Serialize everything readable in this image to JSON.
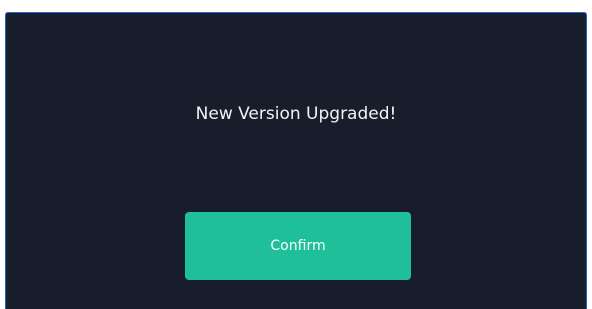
{
  "dialog": {
    "message": "New Version Upgraded!",
    "confirm_label": "Confirm"
  },
  "colors": {
    "dialog_background": "#181d2c",
    "dialog_border": "#2a62c9",
    "accent": "#1fbf99",
    "text": "#f2f3f5"
  }
}
